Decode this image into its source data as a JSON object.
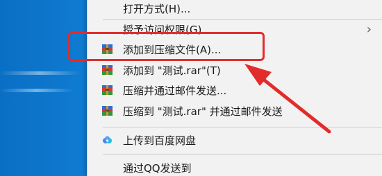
{
  "menu": {
    "items": [
      {
        "label": "打开方式(H)...",
        "icon": "none"
      },
      {
        "label": "授予访问权限(G)",
        "icon": "none",
        "submenu": true
      },
      {
        "label": "添加到压缩文件(A)...",
        "icon": "winrar-icon"
      },
      {
        "label": "添加到 \"测试.rar\"(T)",
        "icon": "winrar-icon"
      },
      {
        "label": "压缩并通过邮件发送...",
        "icon": "winrar-icon"
      },
      {
        "label": "压缩到 \"测试.rar\" 并通过邮件发送",
        "icon": "winrar-icon"
      },
      {
        "label": "上传到百度网盘",
        "icon": "baidu-netdisk-icon"
      },
      {
        "label": "通过QQ发送到",
        "icon": "none"
      }
    ],
    "submenu_arrow": "›"
  },
  "annotation": {
    "box_color": "#e22c2c",
    "arrow_color": "#e22c2c"
  }
}
